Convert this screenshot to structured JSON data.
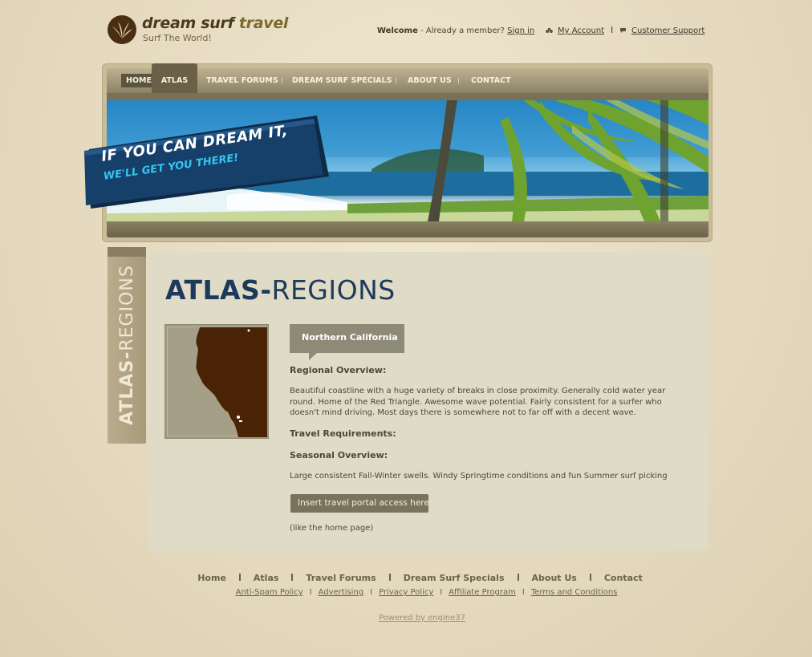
{
  "logo": {
    "title_part1": "dream surf ",
    "title_part2": "travel",
    "tagline": "Surf The World!"
  },
  "top": {
    "welcome_bold": "Welcome",
    "welcome_text": " - Already a member? ",
    "sign_in": "Sign in",
    "my_account": "My Account",
    "separator": "I",
    "customer_support": "Customer Support"
  },
  "nav": {
    "home": "HOME",
    "atlas": "ATLAS",
    "forums": "TRAVEL FORUMS",
    "specials": "DREAM SURF SPECIALS",
    "about": "ABOUT US",
    "contact": "CONTACT"
  },
  "hero": {
    "line1": "IF YOU CAN DREAM IT,",
    "line2": "WE'LL GET YOU THERE!"
  },
  "side_tab": {
    "bold": "ATLAS-",
    "light": "REGIONS"
  },
  "page": {
    "title_bold": "ATLAS-",
    "title_light": "REGIONS",
    "region_name": "Northern California",
    "regional_head": "Regional Overview:",
    "regional_text": "Beautiful coastline with a huge variety of breaks in close proximity. Generally cold water year round. Home of the Red Triangle. Awesome wave potential. Fairly consistent for a surfer who doesn't mind driving. Most days there is somewhere not to far off with a decent wave.",
    "travel_head": "Travel Requirements:",
    "seasonal_head": "Seasonal Overview:",
    "seasonal_text": "Large consistent Fall-Winter swells. Windy Springtime conditions and fun Summer surf picking",
    "portal_button": "Insert travel portal access here",
    "portal_note": "(like the home page)"
  },
  "footer": {
    "nav": [
      "Home",
      "Atlas",
      "Travel Forums",
      "Dream Surf Specials",
      "About Us",
      "Contact"
    ],
    "links": [
      "Anti-Spam Policy",
      "Advertising",
      "Privacy Policy",
      "Affiliate Program",
      "Terms and Conditions"
    ],
    "powered": "Powered by engine37"
  },
  "colors": {
    "background": "#e7dcc3",
    "nav_active": "#6a6048",
    "title_blue": "#1d3a5c",
    "banner_cyan": "#33c6f0",
    "content_panel": "#dfdbc6"
  }
}
